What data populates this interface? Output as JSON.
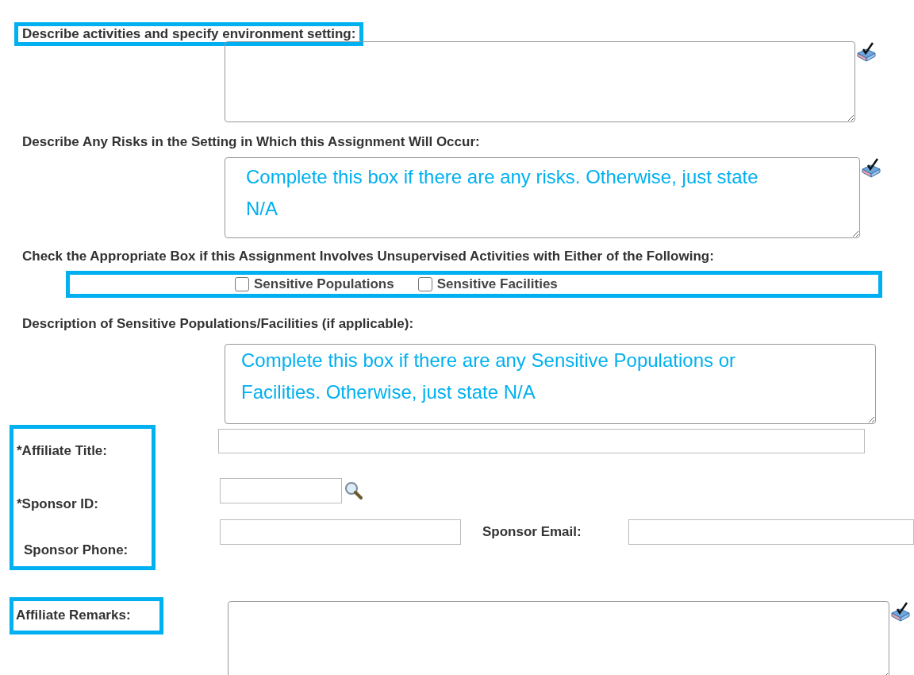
{
  "activities": {
    "label": "Describe activities and specify environment setting:"
  },
  "risks": {
    "label": "Describe Any Risks in the Setting in Which this Assignment Will Occur:",
    "value": "Complete this box if there are any risks. Otherwise, just state N/A"
  },
  "unsupervised": {
    "label": "Check the Appropriate Box if this Assignment Involves Unsupervised Activities with Either of the Following:",
    "options": [
      {
        "label": "Sensitive Populations",
        "checked": false
      },
      {
        "label": "Sensitive Facilities",
        "checked": false
      }
    ]
  },
  "sensitive_description": {
    "label": "Description of Sensitive Populations/Facilities (if applicable):",
    "value": "Complete this box if there are any Sensitive Populations or Facilities. Otherwise, just state N/A"
  },
  "affiliate_title": {
    "label": "*Affiliate Title:"
  },
  "sponsor_id": {
    "label": "*Sponsor ID:"
  },
  "sponsor_phone": {
    "label": "Sponsor Phone:"
  },
  "sponsor_email": {
    "label": "Sponsor Email:"
  },
  "affiliate_remarks": {
    "label": "Affiliate Remarks:"
  }
}
